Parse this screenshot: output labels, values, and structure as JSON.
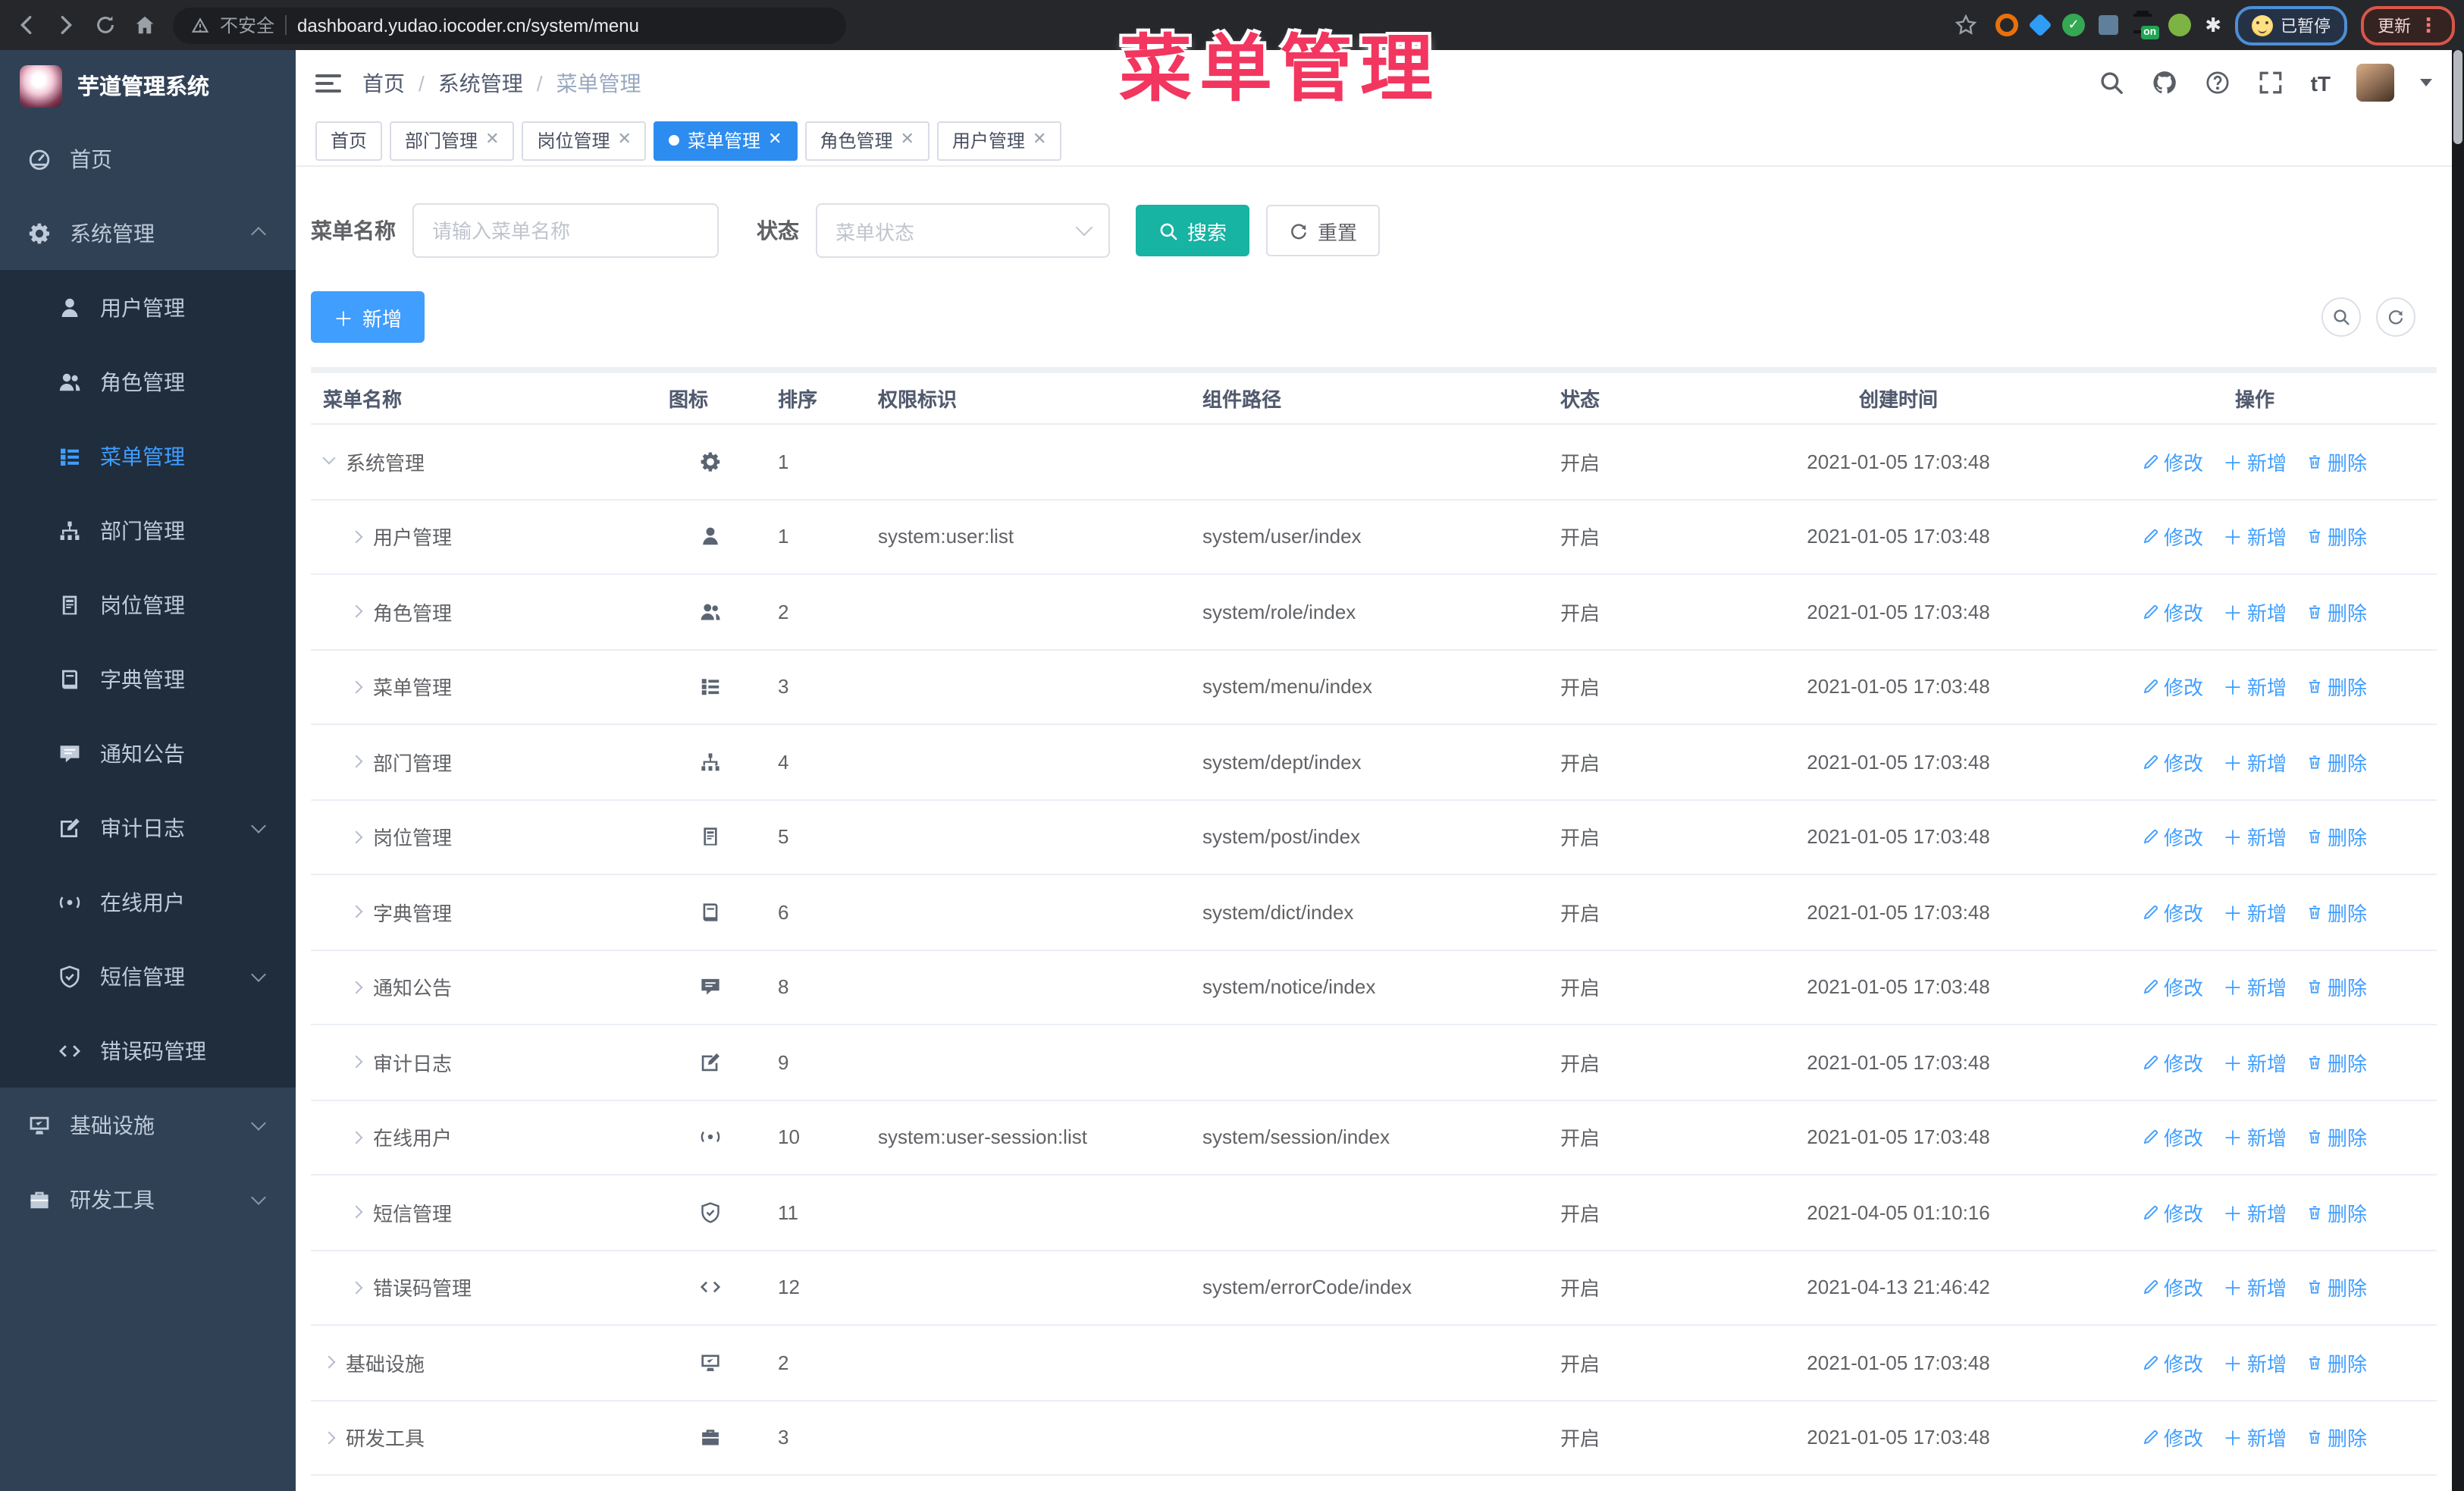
{
  "browser": {
    "security_label": "不安全",
    "url": "dashboard.yudao.iocoder.cn/system/menu",
    "extension_on_badge": "on",
    "paused_badge": "已暂停",
    "update_label": "更新"
  },
  "annotation": {
    "text": "菜单管理",
    "color": "#f2365f"
  },
  "sidebar": {
    "title": "芋道管理系统",
    "items": [
      {
        "label": "首页",
        "icon": "dashboard",
        "level": 0
      },
      {
        "label": "系统管理",
        "icon": "gear",
        "level": 0,
        "arrow": "up"
      },
      {
        "label": "用户管理",
        "icon": "user",
        "level": 1
      },
      {
        "label": "角色管理",
        "icon": "users",
        "level": 1
      },
      {
        "label": "菜单管理",
        "icon": "menu",
        "level": 1,
        "active": true
      },
      {
        "label": "部门管理",
        "icon": "tree",
        "level": 1
      },
      {
        "label": "岗位管理",
        "icon": "badge",
        "level": 1
      },
      {
        "label": "字典管理",
        "icon": "book",
        "level": 1
      },
      {
        "label": "通知公告",
        "icon": "message",
        "level": 1
      },
      {
        "label": "审计日志",
        "icon": "edit",
        "level": 1,
        "arrow": "down"
      },
      {
        "label": "在线用户",
        "icon": "online",
        "level": 1
      },
      {
        "label": "短信管理",
        "icon": "shield",
        "level": 1,
        "arrow": "down"
      },
      {
        "label": "错误码管理",
        "icon": "code",
        "level": 1
      },
      {
        "label": "基础设施",
        "icon": "monitor",
        "level": 0,
        "arrow": "down"
      },
      {
        "label": "研发工具",
        "icon": "toolbox",
        "level": 0,
        "arrow": "down"
      }
    ]
  },
  "header": {
    "breadcrumb": [
      "首页",
      "系统管理",
      "菜单管理"
    ]
  },
  "tabs": [
    {
      "label": "首页",
      "active": false,
      "closable": false
    },
    {
      "label": "部门管理",
      "active": false,
      "closable": true
    },
    {
      "label": "岗位管理",
      "active": false,
      "closable": true
    },
    {
      "label": "菜单管理",
      "active": true,
      "closable": true
    },
    {
      "label": "角色管理",
      "active": false,
      "closable": true
    },
    {
      "label": "用户管理",
      "active": false,
      "closable": true
    }
  ],
  "filters": {
    "name_label": "菜单名称",
    "name_placeholder": "请输入菜单名称",
    "status_label": "状态",
    "status_placeholder": "菜单状态",
    "search_label": "搜索",
    "reset_label": "重置"
  },
  "toolbar": {
    "add_label": "新增"
  },
  "table": {
    "columns": [
      "菜单名称",
      "图标",
      "排序",
      "权限标识",
      "组件路径",
      "状态",
      "创建时间",
      "操作"
    ],
    "action_edit": "修改",
    "action_add": "新增",
    "action_delete": "删除",
    "rows": [
      {
        "name": "系统管理",
        "icon": "gear",
        "level": 0,
        "expanded": true,
        "sort": "1",
        "perm": "",
        "path": "",
        "status": "开启",
        "time": "2021-01-05 17:03:48"
      },
      {
        "name": "用户管理",
        "icon": "user",
        "level": 1,
        "expanded": false,
        "sort": "1",
        "perm": "system:user:list",
        "path": "system/user/index",
        "status": "开启",
        "time": "2021-01-05 17:03:48"
      },
      {
        "name": "角色管理",
        "icon": "users",
        "level": 1,
        "expanded": false,
        "sort": "2",
        "perm": "",
        "path": "system/role/index",
        "status": "开启",
        "time": "2021-01-05 17:03:48"
      },
      {
        "name": "菜单管理",
        "icon": "menu",
        "level": 1,
        "expanded": false,
        "sort": "3",
        "perm": "",
        "path": "system/menu/index",
        "status": "开启",
        "time": "2021-01-05 17:03:48"
      },
      {
        "name": "部门管理",
        "icon": "tree",
        "level": 1,
        "expanded": false,
        "sort": "4",
        "perm": "",
        "path": "system/dept/index",
        "status": "开启",
        "time": "2021-01-05 17:03:48"
      },
      {
        "name": "岗位管理",
        "icon": "badge",
        "level": 1,
        "expanded": false,
        "sort": "5",
        "perm": "",
        "path": "system/post/index",
        "status": "开启",
        "time": "2021-01-05 17:03:48"
      },
      {
        "name": "字典管理",
        "icon": "book",
        "level": 1,
        "expanded": false,
        "sort": "6",
        "perm": "",
        "path": "system/dict/index",
        "status": "开启",
        "time": "2021-01-05 17:03:48"
      },
      {
        "name": "通知公告",
        "icon": "message",
        "level": 1,
        "expanded": false,
        "sort": "8",
        "perm": "",
        "path": "system/notice/index",
        "status": "开启",
        "time": "2021-01-05 17:03:48"
      },
      {
        "name": "审计日志",
        "icon": "edit",
        "level": 1,
        "expanded": false,
        "sort": "9",
        "perm": "",
        "path": "",
        "status": "开启",
        "time": "2021-01-05 17:03:48"
      },
      {
        "name": "在线用户",
        "icon": "online",
        "level": 1,
        "expanded": false,
        "sort": "10",
        "perm": "system:user-session:list",
        "path": "system/session/index",
        "status": "开启",
        "time": "2021-01-05 17:03:48"
      },
      {
        "name": "短信管理",
        "icon": "shield",
        "level": 1,
        "expanded": false,
        "sort": "11",
        "perm": "",
        "path": "",
        "status": "开启",
        "time": "2021-04-05 01:10:16"
      },
      {
        "name": "错误码管理",
        "icon": "code",
        "level": 1,
        "expanded": false,
        "sort": "12",
        "perm": "",
        "path": "system/errorCode/index",
        "status": "开启",
        "time": "2021-04-13 21:46:42"
      },
      {
        "name": "基础设施",
        "icon": "monitor",
        "level": 0,
        "expanded": false,
        "sort": "2",
        "perm": "",
        "path": "",
        "status": "开启",
        "time": "2021-01-05 17:03:48"
      },
      {
        "name": "研发工具",
        "icon": "toolbox",
        "level": 0,
        "expanded": false,
        "sort": "3",
        "perm": "",
        "path": "",
        "status": "开启",
        "time": "2021-01-05 17:03:48"
      }
    ]
  },
  "colors": {
    "accent": "#409eff",
    "search_button": "#17b3a3",
    "sidebar_bg": "#304156",
    "submenu_bg": "#1f2d3d",
    "active_tab": "#2d8cf0",
    "annotation": "#f2365f"
  }
}
